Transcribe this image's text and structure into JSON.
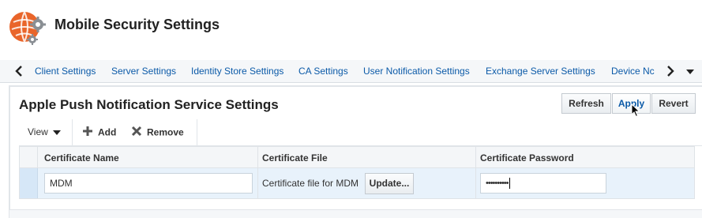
{
  "header": {
    "title": "Mobile Security Settings"
  },
  "tabs": [
    {
      "label": "Client Settings"
    },
    {
      "label": "Server Settings"
    },
    {
      "label": "Identity Store Settings"
    },
    {
      "label": "CA Settings"
    },
    {
      "label": "User Notification Settings"
    },
    {
      "label": "Exchange Server Settings"
    },
    {
      "label": "Device Nc"
    }
  ],
  "section": {
    "title": "Apple Push Notification Service Settings",
    "buttons": {
      "refresh": "Refresh",
      "apply": "Apply",
      "revert": "Revert"
    }
  },
  "toolbar": {
    "view": "View",
    "add": "Add",
    "remove": "Remove"
  },
  "table": {
    "columns": [
      "Certificate Name",
      "Certificate File",
      "Certificate Password"
    ],
    "rows": [
      {
        "name": "MDM",
        "file": "Certificate file for MDM",
        "update": "Update...",
        "password": "••••••••••"
      }
    ]
  },
  "colors": {
    "accent": "#0b5aa8",
    "logo": "#e9652a",
    "selected_row": "#e8f2fb"
  }
}
